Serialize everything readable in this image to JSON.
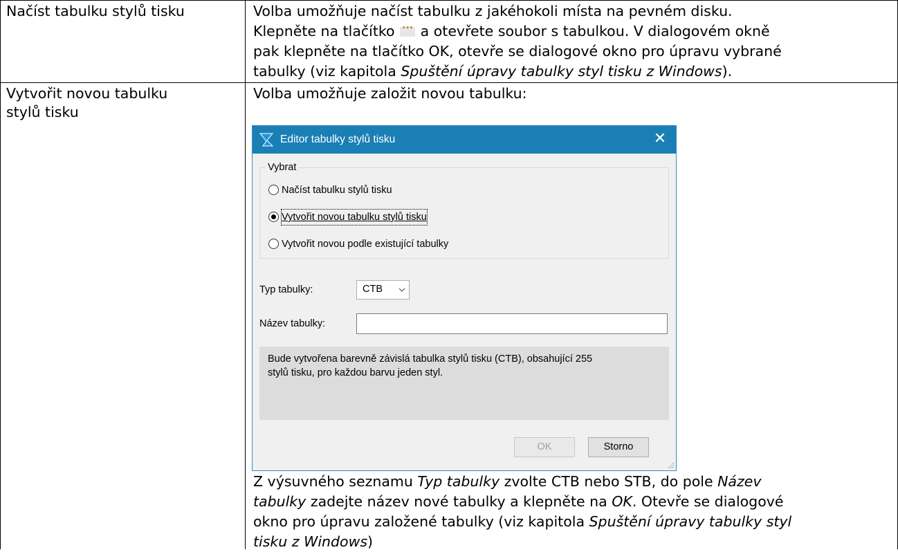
{
  "table": {
    "row1": {
      "label": "Načíst tabulku stylů tisku",
      "desc_line1": "Volba umožňuje načíst tabulku z jakéhokoli místa na pevném disku.",
      "desc_line2_a": "Klepněte na tlačítko",
      "desc_line2_button": "...",
      "desc_line2_b": "a otevřete soubor s tabulkou. V dialogovém okně",
      "desc_line3": "pak klepněte na tlačítko OK, otevře se dialogové okno pro úpravu vybrané",
      "desc_line4_a": "tabulky (viz kapitola ",
      "desc_line4_i": "Spuštění úpravy tabulky styl tisku z Windows",
      "desc_line4_b": ")."
    },
    "row2": {
      "label_line1": "Vytvořit novou tabulku",
      "label_line2": "stylů tisku",
      "intro": "Volba umožňuje založit novou tabulku:",
      "after": {
        "l1_a": "Z výsuvného seznamu ",
        "l1_i": "Typ tabulky",
        "l1_b": " zvolte CTB nebo STB, do pole ",
        "l1_i2": "Název",
        "l2_i": "tabulky",
        "l2_a": " zadejte název nové tabulky a klepněte na ",
        "l2_i2": "OK",
        "l2_b": ". Otevře se dialogové",
        "l3_a": "okno pro úpravu založené tabulky (viz kapitola ",
        "l3_i": "Spuštění úpravy tabulky styl",
        "l4_i": "tisku z Windows",
        "l4_a": ")"
      }
    }
  },
  "dialog": {
    "title": "Editor tabulky stylů tisku",
    "close": "✕",
    "group_label": "Vybrat",
    "options": [
      {
        "label": "Načíst tabulku stylů tisku",
        "checked": false
      },
      {
        "label": "Vytvořit novou tabulku stylů tisku",
        "checked": true
      },
      {
        "label": "Vytvořit novou podle existující tabulky",
        "checked": false
      }
    ],
    "type_label": "Typ tabulky:",
    "type_value": "CTB",
    "name_label": "Název tabulky:",
    "name_value": "",
    "info_line1": "Bude vytvořena barevně závislá tabulka stylů tisku (CTB), obsahující 255",
    "info_line2": "stylů tisku, pro každou barvu  jeden styl.",
    "ok_label": "OK",
    "cancel_label": "Storno",
    "colors": {
      "titlebar": "#1a7fb5",
      "logo": "#2196e0"
    }
  }
}
